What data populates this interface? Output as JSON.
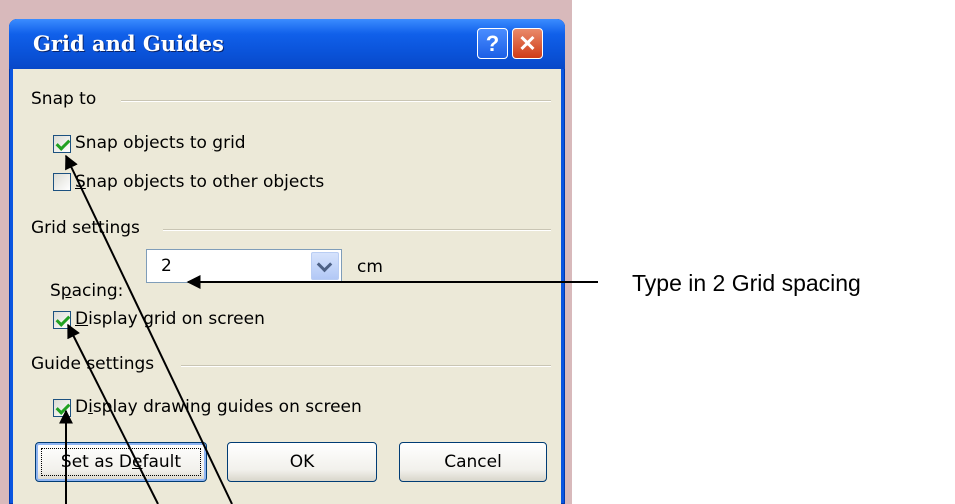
{
  "dialog": {
    "title": "Grid and Guides",
    "help_icon": "?",
    "close_icon": "✕"
  },
  "snap": {
    "header": "Snap to",
    "grid_label_pre": "Snap objects to ",
    "grid_label_u": "g",
    "grid_label_post": "rid",
    "grid_checked": true,
    "objects_label_u": "S",
    "objects_label_post": "nap objects to other objects",
    "objects_checked": false
  },
  "grid": {
    "header": "Grid settings",
    "spacing_label_pre": "S",
    "spacing_label_u": "p",
    "spacing_label_post": "acing:",
    "spacing_value": "2",
    "unit": "cm",
    "display_label_u": "D",
    "display_label_post": "isplay grid on screen",
    "display_checked": true
  },
  "guides": {
    "header": "Guide settings",
    "display_label_pre": "D",
    "display_label_u": "i",
    "display_label_post": "splay drawing guides on screen",
    "display_checked": true
  },
  "buttons": {
    "default_pre": "Set as D",
    "default_u": "e",
    "default_post": "fault",
    "ok": "OK",
    "cancel": "Cancel"
  },
  "annotation": {
    "text": "Type in 2 Grid spacing"
  },
  "colors": {
    "titlebar": "#0a55e0",
    "client": "#ece9d8",
    "check": "#21a121"
  }
}
